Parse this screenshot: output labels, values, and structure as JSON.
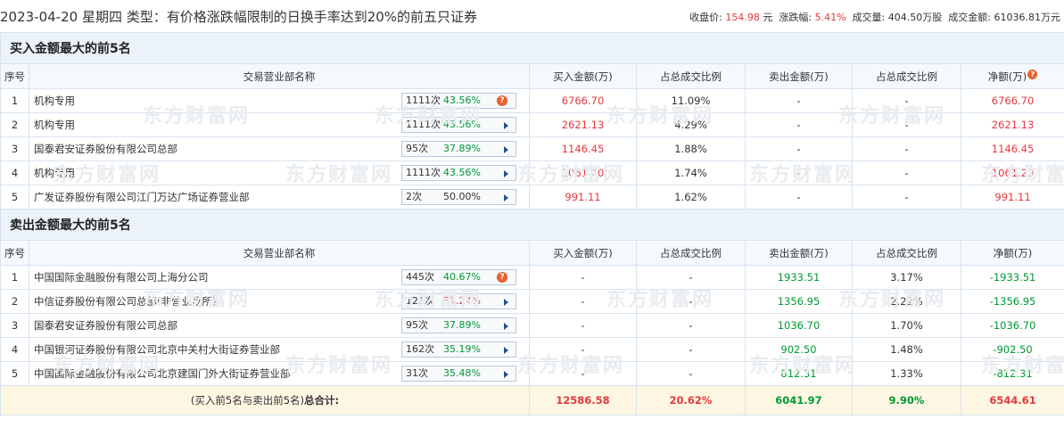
{
  "header": {
    "title": "2023-04-20 星期四 类型：有价格涨跌幅限制的日换手率达到20%的前五只证券",
    "close_label": "收盘价:",
    "close_value": "154.98",
    "close_unit": "元",
    "change_label": "涨跌幅:",
    "change_value": "5.41%",
    "volume_label": "成交量:",
    "volume_value": "404.50万股",
    "turnover_label": "成交金额:",
    "turnover_value": "61036.81万元"
  },
  "watermark": "东方财富网",
  "buy_section": {
    "title": "买入金额最大的前5名",
    "headers": [
      "序号",
      "交易营业部名称",
      "买入金额(万)",
      "占总成交比例",
      "卖出金额(万)",
      "占总成交比例",
      "净额(万)"
    ],
    "net_help_icon": "?",
    "rows": [
      {
        "idx": "1",
        "name": "机构专用",
        "count": "1111次",
        "rate": "43.56%",
        "rate_color": "green",
        "icon": "question-icon",
        "buy": "6766.70",
        "buy_pct": "11.09%",
        "sell": "-",
        "sell_pct": "-",
        "net": "6766.70"
      },
      {
        "idx": "2",
        "name": "机构专用",
        "count": "1111次",
        "rate": "43.56%",
        "rate_color": "green",
        "icon": "arrow-icon",
        "buy": "2621.13",
        "buy_pct": "4.29%",
        "sell": "-",
        "sell_pct": "-",
        "net": "2621.13"
      },
      {
        "idx": "3",
        "name": "国泰君安证券股份有限公司总部",
        "count": "95次",
        "rate": "37.89%",
        "rate_color": "green",
        "icon": "arrow-icon",
        "buy": "1146.45",
        "buy_pct": "1.88%",
        "sell": "-",
        "sell_pct": "-",
        "net": "1146.45"
      },
      {
        "idx": "4",
        "name": "机构专用",
        "count": "1111次",
        "rate": "43.56%",
        "rate_color": "green",
        "icon": "arrow-icon",
        "buy": "1061.20",
        "buy_pct": "1.74%",
        "sell": "-",
        "sell_pct": "-",
        "net": "1061.20"
      },
      {
        "idx": "5",
        "name": "广发证券股份有限公司江门万达广场证券营业部",
        "count": "2次",
        "rate": "50.00%",
        "rate_color": "black",
        "icon": "arrow-icon",
        "buy": "991.11",
        "buy_pct": "1.62%",
        "sell": "-",
        "sell_pct": "-",
        "net": "991.11"
      }
    ]
  },
  "sell_section": {
    "title": "卖出金额最大的前5名",
    "headers": [
      "序号",
      "交易营业部名称",
      "买入金额(万)",
      "占总成交比例",
      "卖出金额(万)",
      "占总成交比例",
      "净额(万)"
    ],
    "rows": [
      {
        "idx": "1",
        "name": "中国国际金融股份有限公司上海分公司",
        "count": "445次",
        "rate": "40.67%",
        "rate_color": "green",
        "icon": "question-icon",
        "buy": "-",
        "buy_pct": "-",
        "sell": "1933.51",
        "sell_pct": "3.17%",
        "net": "-1933.51"
      },
      {
        "idx": "2",
        "name": "中信证券股份有限公司总部(非营业场所)",
        "count": "121次",
        "rate": "51.24%",
        "rate_color": "red",
        "icon": "arrow-icon",
        "buy": "-",
        "buy_pct": "-",
        "sell": "1356.95",
        "sell_pct": "2.22%",
        "net": "-1356.95"
      },
      {
        "idx": "3",
        "name": "国泰君安证券股份有限公司总部",
        "count": "95次",
        "rate": "37.89%",
        "rate_color": "green",
        "icon": "arrow-icon",
        "buy": "-",
        "buy_pct": "-",
        "sell": "1036.70",
        "sell_pct": "1.70%",
        "net": "-1036.70"
      },
      {
        "idx": "4",
        "name": "中国银河证券股份有限公司北京中关村大街证券营业部",
        "count": "162次",
        "rate": "35.19%",
        "rate_color": "green",
        "icon": "arrow-icon",
        "buy": "-",
        "buy_pct": "-",
        "sell": "902.50",
        "sell_pct": "1.48%",
        "net": "-902.50"
      },
      {
        "idx": "5",
        "name": "中国国际金融股份有限公司北京建国门外大街证券营业部",
        "count": "31次",
        "rate": "35.48%",
        "rate_color": "green",
        "icon": "arrow-icon",
        "buy": "-",
        "buy_pct": "-",
        "sell": "812.31",
        "sell_pct": "1.33%",
        "net": "-812.31"
      }
    ]
  },
  "total": {
    "label_prefix": "(买入前5名与卖出前5名)",
    "label_bold": "总合计:",
    "buy": "12586.58",
    "buy_pct": "20.62%",
    "sell": "6041.97",
    "sell_pct": "9.90%",
    "net": "6544.61"
  },
  "colors": {
    "red": "#e4393c",
    "green": "#009933",
    "header_bg": "#ebf2fa",
    "total_bg": "#fdf6e3"
  }
}
